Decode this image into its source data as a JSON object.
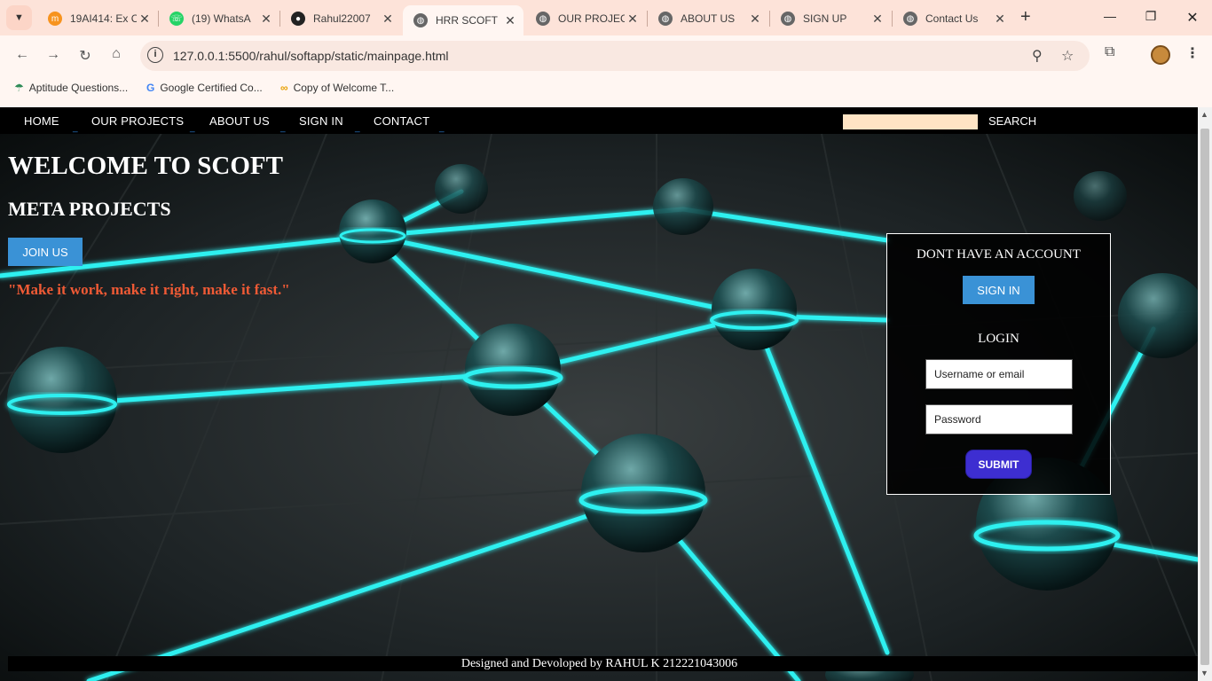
{
  "browser": {
    "tabs": [
      {
        "title": "19AI414: Ex C",
        "favicon": "moodle-icon",
        "active": false
      },
      {
        "title": "(19) WhatsA",
        "favicon": "whatsapp-icon",
        "active": false
      },
      {
        "title": "Rahul22007",
        "favicon": "github-icon",
        "active": false
      },
      {
        "title": "HRR SCOFT",
        "favicon": "globe-icon",
        "active": true
      },
      {
        "title": "OUR PROJEC",
        "favicon": "globe-icon",
        "active": false
      },
      {
        "title": "ABOUT US",
        "favicon": "globe-icon",
        "active": false
      },
      {
        "title": "SIGN UP",
        "favicon": "globe-icon",
        "active": false
      },
      {
        "title": "Contact Us",
        "favicon": "globe-icon",
        "active": false
      }
    ],
    "url": "127.0.0.1:5500/rahul/softapp/static/mainpage.html",
    "bookmarks": [
      {
        "label": "Aptitude Questions...",
        "icon": "umbrella-icon"
      },
      {
        "label": "Google Certified Co...",
        "icon": "google-icon"
      },
      {
        "label": "Copy of Welcome T...",
        "icon": "coursera-icon"
      }
    ]
  },
  "site": {
    "nav": [
      "HOME",
      "OUR PROJECTS",
      "ABOUT US",
      "SIGN IN",
      "CONTACT"
    ],
    "search_label": "SEARCH",
    "search_value": "",
    "welcome": "WELCOME TO SCOFT",
    "subtitle": "META PROJECTS",
    "join_label": "JOIN US",
    "quote": "\"Make it work, make it right, make it fast.\"",
    "login": {
      "no_account": "DONT HAVE AN ACCOUNT",
      "signin_label": "SIGN IN",
      "heading": "LOGIN",
      "username_placeholder": "Username or email",
      "password_placeholder": "Password",
      "submit_label": "SUBMIT"
    },
    "footer": "Designed and Devoloped by RAHUL K 212221043006"
  },
  "colors": {
    "accent_blue": "#3a92d6",
    "submit_purple": "#3d2ed1",
    "quote_orange": "#ef5a35",
    "search_bg": "#ffe4c4",
    "glow_cyan": "#2ef0f0"
  }
}
